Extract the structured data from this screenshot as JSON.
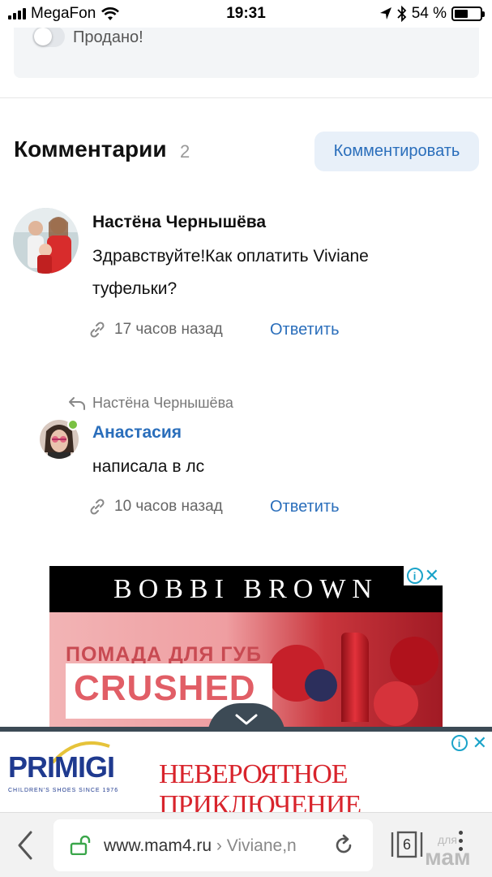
{
  "status_bar": {
    "carrier": "MegaFon",
    "time": "19:31",
    "battery": "54 %",
    "battery_level_percent": 54
  },
  "sold_toggle": {
    "label": "Продано!",
    "checked": false
  },
  "comments": {
    "title": "Комментарии",
    "count": "2",
    "comment_button": "Комментировать",
    "items": [
      {
        "author": "Настёна Чернышёва",
        "text": "Здравствуйте!Как оплатить Viviane туфельки?",
        "time": "17 часов назад",
        "reply_label": "Ответить"
      },
      {
        "reply_to": "Настёна Чернышёва",
        "author": "Анастасия",
        "text": "написала в лс",
        "time": "10 часов назад",
        "reply_label": "Ответить",
        "online": true
      }
    ]
  },
  "ad": {
    "brand": "BOBBI BROWN",
    "headline": "ПОМАДА ДЛЯ ГУБ",
    "product": "CRUSHED"
  },
  "banner": {
    "brand": "PRIMIGI",
    "brand_sub": "CHILDREN'S SHOES SINCE 1976",
    "slogan": "НЕВЕРОЯТНОЕ ПРИКЛЮЧЕНИЕ"
  },
  "browser": {
    "domain": "www.mam4.ru",
    "path": " › Viviane,n",
    "tab_count": "6"
  },
  "watermark": {
    "small": "для",
    "large": "мам"
  },
  "colors": {
    "link": "#2a6ebb",
    "button_bg": "#e8f0f9",
    "online": "#7ac142",
    "banner_red": "#d8242c",
    "banner_blue": "#1f3a8f"
  }
}
